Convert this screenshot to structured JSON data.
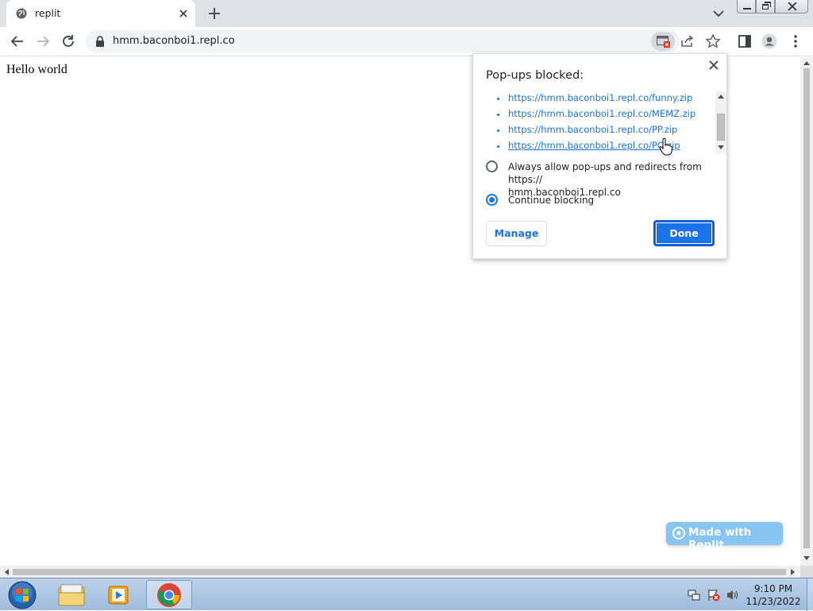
{
  "browser": {
    "tab": {
      "title": "replit"
    },
    "address": {
      "url": "hmm.baconboi1.repl.co"
    }
  },
  "page": {
    "body_text": "Hello world",
    "badge_label": "Made with Replit"
  },
  "popup_bubble": {
    "title": "Pop-ups blocked:",
    "blocked_links": [
      "https://hmm.baconboi1.repl.co/funny.zip",
      "https://hmm.baconboi1.repl.co/MEMZ.zip",
      "https://hmm.baconboi1.repl.co/PP.zip",
      "https://hmm.baconboi1.repl.co/PO.zip"
    ],
    "option_always_allow": "Always allow pop-ups and redirects from https://hmm.baconboi1.repl.co",
    "option_always_allow_line1": "Always allow pop-ups and redirects from https://",
    "option_always_allow_line2": "hmm.baconboi1.repl.co",
    "option_continue_blocking": "Continue blocking",
    "selected_option": "Continue blocking",
    "manage_label": "Manage",
    "done_label": "Done"
  },
  "taskbar": {
    "time": "9:10 PM",
    "date": "11/23/2022"
  },
  "colors": {
    "link_blue": "#1a73e8",
    "tabstrip_bg": "#dee1e6",
    "badge_bg": "#88c5f2"
  }
}
